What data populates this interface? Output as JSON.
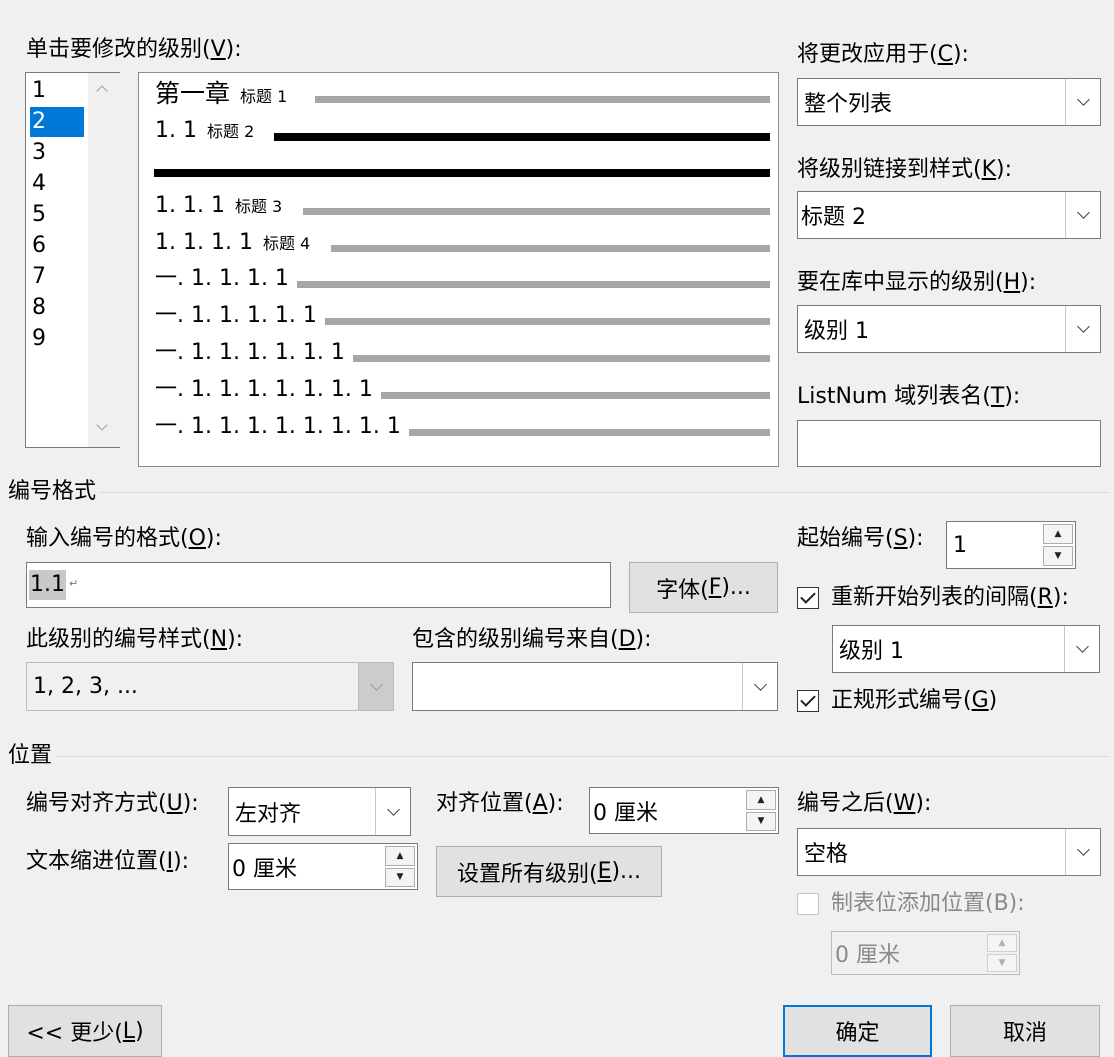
{
  "level_list": {
    "label_prefix": "单击要修改的级别(",
    "label_key": "V",
    "label_suffix": "):",
    "items": [
      "1",
      "2",
      "3",
      "4",
      "5",
      "6",
      "7",
      "8",
      "9"
    ],
    "selected": "2"
  },
  "preview": {
    "lines": [
      {
        "number": "第一章",
        "style": "标题 1"
      },
      {
        "number": "1. 1",
        "style": "标题 2"
      },
      {
        "number": "",
        "style": ""
      },
      {
        "number": "1. 1. 1",
        "style": "标题 3"
      },
      {
        "number": "1. 1. 1. 1",
        "style": "标题 4"
      },
      {
        "number": "一. 1. 1. 1. 1",
        "style": ""
      },
      {
        "number": "一. 1. 1. 1. 1. 1",
        "style": ""
      },
      {
        "number": "一. 1. 1. 1. 1. 1. 1",
        "style": ""
      },
      {
        "number": "一. 1. 1. 1. 1. 1. 1. 1",
        "style": ""
      },
      {
        "number": "一. 1. 1. 1. 1. 1. 1. 1. 1",
        "style": ""
      }
    ]
  },
  "apply_to": {
    "label_prefix": "将更改应用于(",
    "label_key": "C",
    "label_suffix": "):",
    "value": "整个列表"
  },
  "link_style": {
    "label_prefix": "将级别链接到样式(",
    "label_key": "K",
    "label_suffix": "):",
    "value": "标题 2"
  },
  "gallery_level": {
    "label_prefix": "要在库中显示的级别(",
    "label_key": "H",
    "label_suffix": "):",
    "value": "级别 1"
  },
  "listnum": {
    "label_prefix": "ListNum 域列表名(",
    "label_key": "T",
    "label_suffix": "):",
    "value": ""
  },
  "number_format": {
    "section_title": "编号格式",
    "format_label_prefix": "输入编号的格式(",
    "format_label_key": "O",
    "format_label_suffix": "):",
    "format_value": "1.1",
    "format_mark": "↵",
    "font_button_prefix": "字体(",
    "font_button_key": "F",
    "font_button_suffix": ")...",
    "style_label_prefix": "此级别的编号样式(",
    "style_label_key": "N",
    "style_label_suffix": "):",
    "style_value": "1, 2, 3, ...",
    "include_label_prefix": "包含的级别编号来自(",
    "include_label_key": "D",
    "include_label_suffix": "):",
    "include_value": "",
    "start_label_prefix": "起始编号(",
    "start_label_key": "S",
    "start_label_suffix": "):",
    "start_value": "1",
    "restart_label_prefix": "重新开始列表的间隔(",
    "restart_label_key": "R",
    "restart_label_suffix": "):",
    "restart_checked": true,
    "restart_value": "级别 1",
    "legal_label_prefix": "正规形式编号(",
    "legal_label_key": "G",
    "legal_label_suffix": ")",
    "legal_checked": true
  },
  "position": {
    "section_title": "位置",
    "align_label_prefix": "编号对齐方式(",
    "align_label_key": "U",
    "align_label_suffix": "):",
    "align_value": "左对齐",
    "at_label_prefix": "对齐位置(",
    "at_label_key": "A",
    "at_label_suffix": "):",
    "at_value": "0 厘米",
    "indent_label_prefix": "文本缩进位置(",
    "indent_label_key": "I",
    "indent_label_suffix": "):",
    "indent_value": "0 厘米",
    "set_all_prefix": "设置所有级别(",
    "set_all_key": "E",
    "set_all_suffix": ")...",
    "follow_label_prefix": "编号之后(",
    "follow_label_key": "W",
    "follow_label_suffix": "):",
    "follow_value": "空格",
    "tab_label": "制表位添加位置(B):",
    "tab_checked": false,
    "tab_value": "0 厘米"
  },
  "footer": {
    "less_prefix": "<< 更少(",
    "less_key": "L",
    "less_suffix": ")",
    "ok": "确定",
    "cancel": "取消"
  }
}
